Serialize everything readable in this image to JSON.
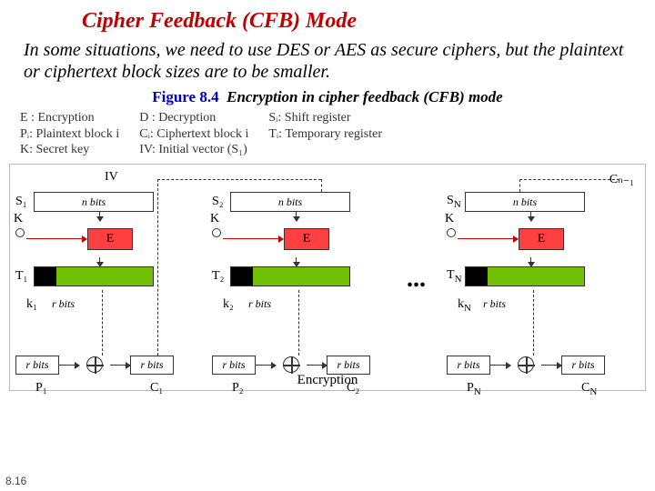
{
  "title": "Cipher Feedback (CFB) Mode",
  "intro": "In some situations, we need to use DES or AES as secure ciphers, but the plaintext or ciphertext block sizes are to be smaller.",
  "figure": {
    "num": "Figure 8.4",
    "caption": "Encryption in cipher feedback (CFB) mode"
  },
  "legend": {
    "c1a": "E : Encryption",
    "c1b": "Pᵢ: Plaintext block i",
    "c1c": "K: Secret key",
    "c2a": "D :  Decryption",
    "c2b": "Cᵢ: Ciphertext block i",
    "c2c": "IV: Initial vector (S₁)",
    "c3a": "Sᵢ: Shift register",
    "c3b": "Tᵢ: Temporary register"
  },
  "stage1": {
    "iv": "IV",
    "S": "S₁",
    "nbits": "n bits",
    "K": "K",
    "E": "E",
    "T": "T₁",
    "k": "k₁",
    "rbits": "r bits",
    "P": "P₁",
    "C": "C₁"
  },
  "stage2": {
    "feed": "",
    "S": "S₂",
    "nbits": "n bits",
    "K": "K",
    "E": "E",
    "T": "T₂",
    "k": "k₂",
    "rbits": "r bits",
    "P": "P₂",
    "C": "C₂"
  },
  "stage3": {
    "feed": "C_{N-1}",
    "S": "S_N",
    "nbits": "n bits",
    "K": "K",
    "E": "E",
    "T": "T_N",
    "k": "k_N",
    "rbits": "r bits",
    "P": "P_N",
    "C": "C_N"
  },
  "feedN": "Cₙ₋₁",
  "ellipsis": "...",
  "enc_label": "Encryption",
  "pagenum": "8.16"
}
